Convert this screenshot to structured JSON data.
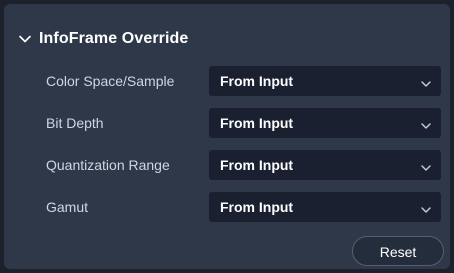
{
  "section": {
    "title": "InfoFrame Override",
    "collapse_icon": "chevron-down-icon"
  },
  "fields": [
    {
      "label": "Color Space/Sample",
      "value": "From Input"
    },
    {
      "label": "Bit Depth",
      "value": "From Input"
    },
    {
      "label": "Quantization Range",
      "value": "From Input"
    },
    {
      "label": "Gamut",
      "value": "From Input"
    }
  ],
  "dropdown_icon": "chevron-down-icon",
  "actions": {
    "reset_label": "Reset"
  },
  "colors": {
    "panel_bg": "#2e3848",
    "select_bg": "#1a2030",
    "text": "#ffffff",
    "label_text": "#cfd6e2"
  }
}
